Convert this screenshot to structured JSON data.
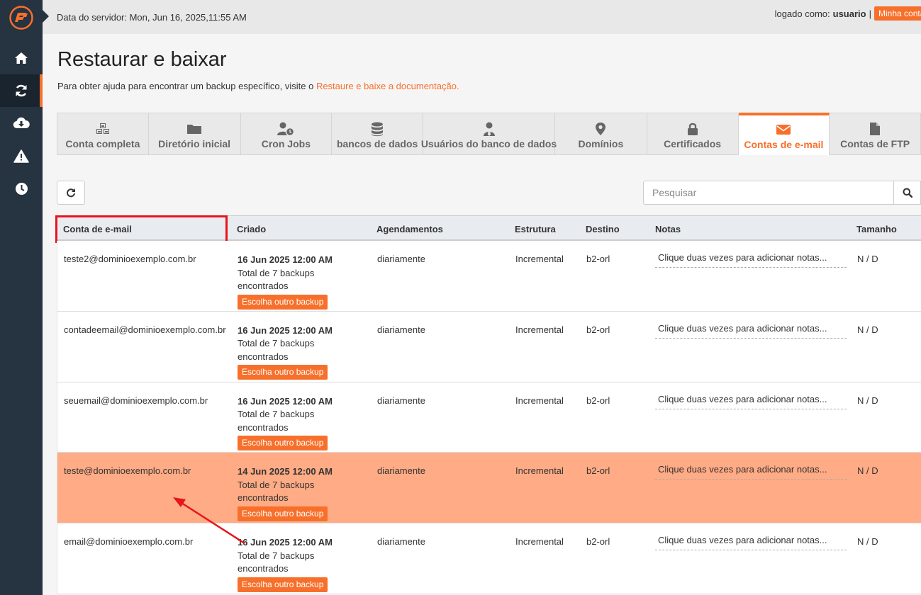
{
  "topbar": {
    "server_date": "Data do servidor: Mon, Jun 16, 2025,11:55 AM",
    "logged_as_label": "logado como:",
    "username": "usuario",
    "separator": "|",
    "account_button": "Minha conta"
  },
  "sidebar": {
    "items": [
      {
        "icon": "home-icon"
      },
      {
        "icon": "restore-icon",
        "active": true
      },
      {
        "icon": "cloud-download-icon"
      },
      {
        "icon": "warning-icon"
      },
      {
        "icon": "clock-icon"
      }
    ]
  },
  "page": {
    "title": "Restaurar e baixar",
    "help_text": "Para obter ajuda para encontrar um backup específico, visite o ",
    "help_link": "Restaure e baixe a documentação."
  },
  "tabs": [
    {
      "label": "Conta completa",
      "icon": "cubes-icon"
    },
    {
      "label": "Diretório inicial",
      "icon": "folder-icon"
    },
    {
      "label": "Cron Jobs",
      "icon": "user-clock-icon"
    },
    {
      "label": "bancos de dados",
      "icon": "database-icon"
    },
    {
      "label": "Usuários do banco de dados",
      "icon": "user-tie-icon"
    },
    {
      "label": "Domínios",
      "icon": "map-marker-icon"
    },
    {
      "label": "Certificados",
      "icon": "lock-icon"
    },
    {
      "label": "Contas de e-mail",
      "icon": "envelope-icon",
      "active": true
    },
    {
      "label": "Contas de FTP",
      "icon": "file-icon"
    }
  ],
  "search": {
    "placeholder": "Pesquisar"
  },
  "table": {
    "headers": {
      "email": "Conta de e-mail",
      "created": "Criado",
      "schedules": "Agendamentos",
      "structure": "Estrutura",
      "destination": "Destino",
      "notes": "Notas",
      "size": "Tamanho"
    },
    "rows": [
      {
        "email": "teste2@dominioexemplo.com.br",
        "date": "16 Jun 2025 12:00 AM",
        "total": "Total de 7 backups",
        "found": "encontrados",
        "button": "Escolha outro backup",
        "schedule": "diariamente",
        "structure": "Incremental",
        "destination": "b2-orl",
        "notes": "Clique duas vezes para adicionar notas...",
        "size": "N / D"
      },
      {
        "email": "contadeemail@dominioexemplo.com.br",
        "date": "16 Jun 2025 12:00 AM",
        "total": "Total de 7 backups",
        "found": "encontrados",
        "button": "Escolha outro backup",
        "schedule": "diariamente",
        "structure": "Incremental",
        "destination": "b2-orl",
        "notes": "Clique duas vezes para adicionar notas...",
        "size": "N / D"
      },
      {
        "email": "seuemail@dominioexemplo.com.br",
        "date": "16 Jun 2025 12:00 AM",
        "total": "Total de 7 backups",
        "found": "encontrados",
        "button": "Escolha outro backup",
        "schedule": "diariamente",
        "structure": "Incremental",
        "destination": "b2-orl",
        "notes": "Clique duas vezes para adicionar notas...",
        "size": "N / D"
      },
      {
        "email": "teste@dominioexemplo.com.br",
        "date": "14 Jun 2025 12:00 AM",
        "total": "Total de 7 backups",
        "found": "encontrados",
        "button": "Escolha outro backup",
        "schedule": "diariamente",
        "structure": "Incremental",
        "destination": "b2-orl",
        "notes": "Clique duas vezes para adicionar notas...",
        "size": "N / D",
        "selected": true
      },
      {
        "email": "email@dominioexemplo.com.br",
        "date": "16 Jun 2025 12:00 AM",
        "total": "Total de 7 backups",
        "found": "encontrados",
        "button": "Escolha outro backup",
        "schedule": "diariamente",
        "structure": "Incremental",
        "destination": "b2-orl",
        "notes": "Clique duas vezes para adicionar notas...",
        "size": "N / D"
      }
    ]
  },
  "colors": {
    "accent": "#f7702b",
    "sidebar": "#263340",
    "selected_row": "#ffab85",
    "annotation": "#e5151b"
  }
}
